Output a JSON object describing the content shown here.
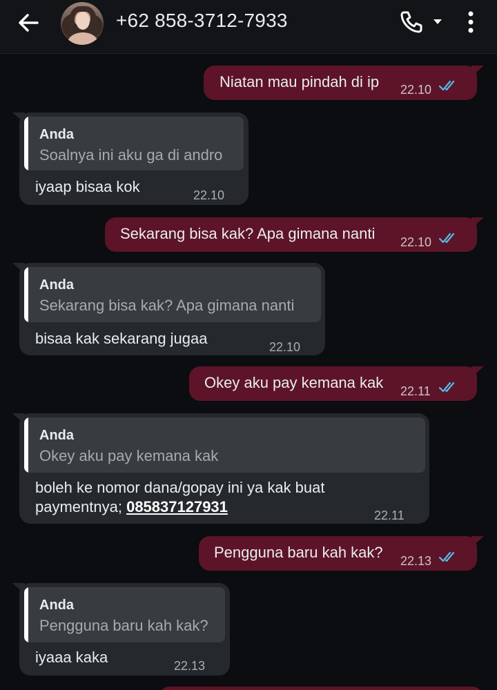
{
  "header": {
    "contact": "+62 858-3712-7933",
    "icons": {
      "back": "arrow-left-icon",
      "call": "phone-icon",
      "caret": "caret-down-icon",
      "menu": "more-vertical-icon"
    }
  },
  "colors": {
    "background": "#0b0d10",
    "header": "#121418",
    "outgoing_bubble": "#5d1428",
    "incoming_bubble": "#25292d",
    "quote_box": "#383c40",
    "read_ticks": "#53bdeb"
  },
  "messages": [
    {
      "direction": "out",
      "text": "Niatan mau pindah di ip",
      "time": "22.10",
      "status": "read"
    },
    {
      "direction": "in",
      "quote_author": "Anda",
      "quote_text": "Soalnya ini aku ga di andro",
      "text": "iyaap bisaa kok",
      "time": "22.10"
    },
    {
      "direction": "out",
      "text": "Sekarang bisa kak? Apa gimana nanti",
      "time": "22.10",
      "status": "read"
    },
    {
      "direction": "in",
      "quote_author": "Anda",
      "quote_text": "Sekarang bisa kak? Apa gimana nanti",
      "text": "bisaa kak sekarang jugaa",
      "time": "22.10"
    },
    {
      "direction": "out",
      "text": "Okey aku pay kemana kak",
      "time": "22.11",
      "status": "read"
    },
    {
      "direction": "in",
      "quote_author": "Anda",
      "quote_text": "Okey aku pay kemana kak",
      "text_line1": "boleh ke nomor dana/gopay ini ya kak buat",
      "text_line2_prefix": "paymentnya; ",
      "text_line2_link": "085837127931",
      "time": "22.11"
    },
    {
      "direction": "out",
      "text": "Pengguna baru kah kak?",
      "time": "22.13",
      "status": "read"
    },
    {
      "direction": "in",
      "quote_author": "Anda",
      "quote_text": "Pengguna baru kah kak?",
      "text": "iyaaa kaka",
      "time": "22.13"
    }
  ]
}
